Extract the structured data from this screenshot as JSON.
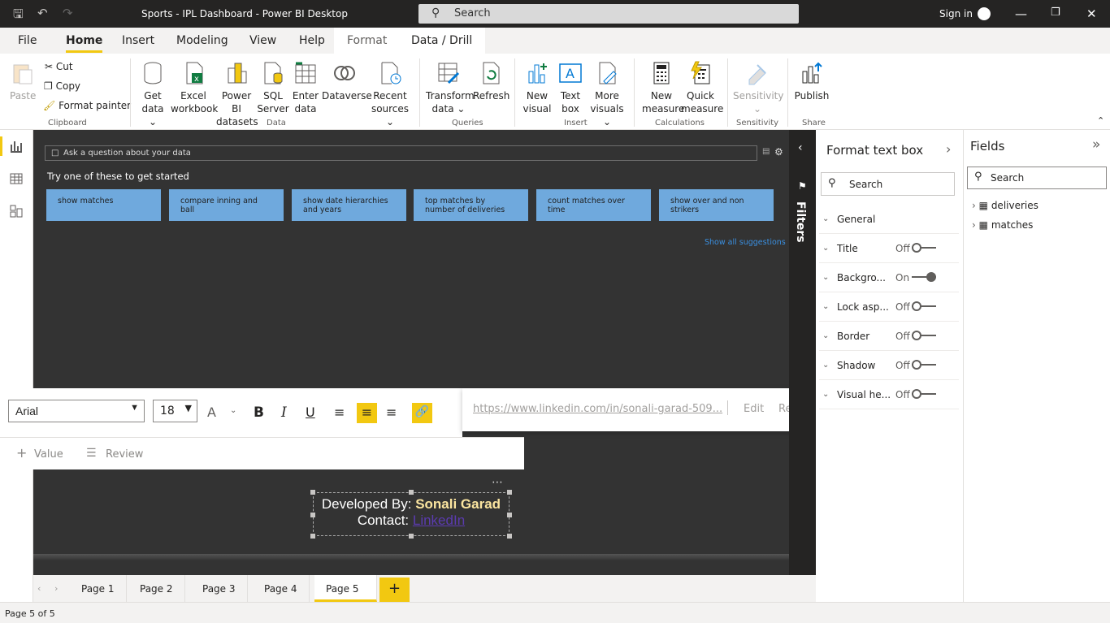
{
  "window": {
    "title": "Sports - IPL Dashboard - Power BI Desktop",
    "search_placeholder": "Search",
    "signin": "Sign in"
  },
  "menu": {
    "file": "File",
    "home": "Home",
    "insert": "Insert",
    "modeling": "Modeling",
    "view": "View",
    "help": "Help",
    "format": "Format",
    "data_drill": "Data / Drill"
  },
  "ribbon": {
    "paste": "Paste",
    "cut": "Cut",
    "copy": "Copy",
    "format_painter": "Format painter",
    "clipboard": "Clipboard",
    "get_data": [
      "Get",
      "data"
    ],
    "excel": [
      "Excel",
      "workbook"
    ],
    "pbi_datasets": [
      "Power BI",
      "datasets"
    ],
    "sql": [
      "SQL",
      "Server"
    ],
    "enter_data": [
      "Enter",
      "data"
    ],
    "dataverse": "Dataverse",
    "recent": [
      "Recent",
      "sources"
    ],
    "data_group": "Data",
    "transform": [
      "Transform",
      "data"
    ],
    "refresh": "Refresh",
    "queries": "Queries",
    "new_visual": [
      "New",
      "visual"
    ],
    "text_box": [
      "Text",
      "box"
    ],
    "more_visuals": [
      "More",
      "visuals"
    ],
    "insert_group": "Insert",
    "new_measure": [
      "New",
      "measure"
    ],
    "quick_measure": [
      "Quick",
      "measure"
    ],
    "calculations": "Calculations",
    "sensitivity": "Sensitivity",
    "sensitivity_group": "Sensitivity",
    "publish": "Publish",
    "share": "Share"
  },
  "qna": {
    "placeholder": "Ask a question about your data",
    "prompt": "Try one of these to get started",
    "suggestions": [
      "show matches",
      "compare inning and ball",
      "show date hierarchies and years",
      "top matches by number of deliveries",
      "count matches over time",
      "show over and non strikers"
    ],
    "show_all": "Show all suggestions"
  },
  "format_toolbar": {
    "font": "Arial",
    "size": "18"
  },
  "value_bar": {
    "value": "Value",
    "review": "Review"
  },
  "link_bar": {
    "url": "https://www.linkedin.com/in/sonali-garad-509...",
    "edit": "Edit",
    "remove": "Remove"
  },
  "textbox": {
    "line1_prefix": "Developed By: ",
    "name": "Sonali Garad",
    "line2_prefix": "Contact: ",
    "link": "LinkedIn"
  },
  "filters": {
    "label": "Filters"
  },
  "format_pane": {
    "title": "Format text box",
    "search": "Search",
    "rows": [
      {
        "label": "General",
        "state": ""
      },
      {
        "label": "Title",
        "state": "Off"
      },
      {
        "label": "Backgro...",
        "state": "On"
      },
      {
        "label": "Lock asp...",
        "state": "Off"
      },
      {
        "label": "Border",
        "state": "Off"
      },
      {
        "label": "Shadow",
        "state": "Off"
      },
      {
        "label": "Visual he...",
        "state": "Off"
      }
    ]
  },
  "fields_pane": {
    "title": "Fields",
    "search": "Search",
    "tables": [
      "deliveries",
      "matches"
    ]
  },
  "pages": {
    "tabs": [
      "Page 1",
      "Page 2",
      "Page 3",
      "Page 4",
      "Page 5"
    ],
    "active": "Page 5",
    "add": "+"
  },
  "status": {
    "text": "Page 5 of 5"
  },
  "colors": {
    "accent": "#f2c811",
    "canvas": "#333333",
    "suggestion": "#6fa9dd"
  }
}
